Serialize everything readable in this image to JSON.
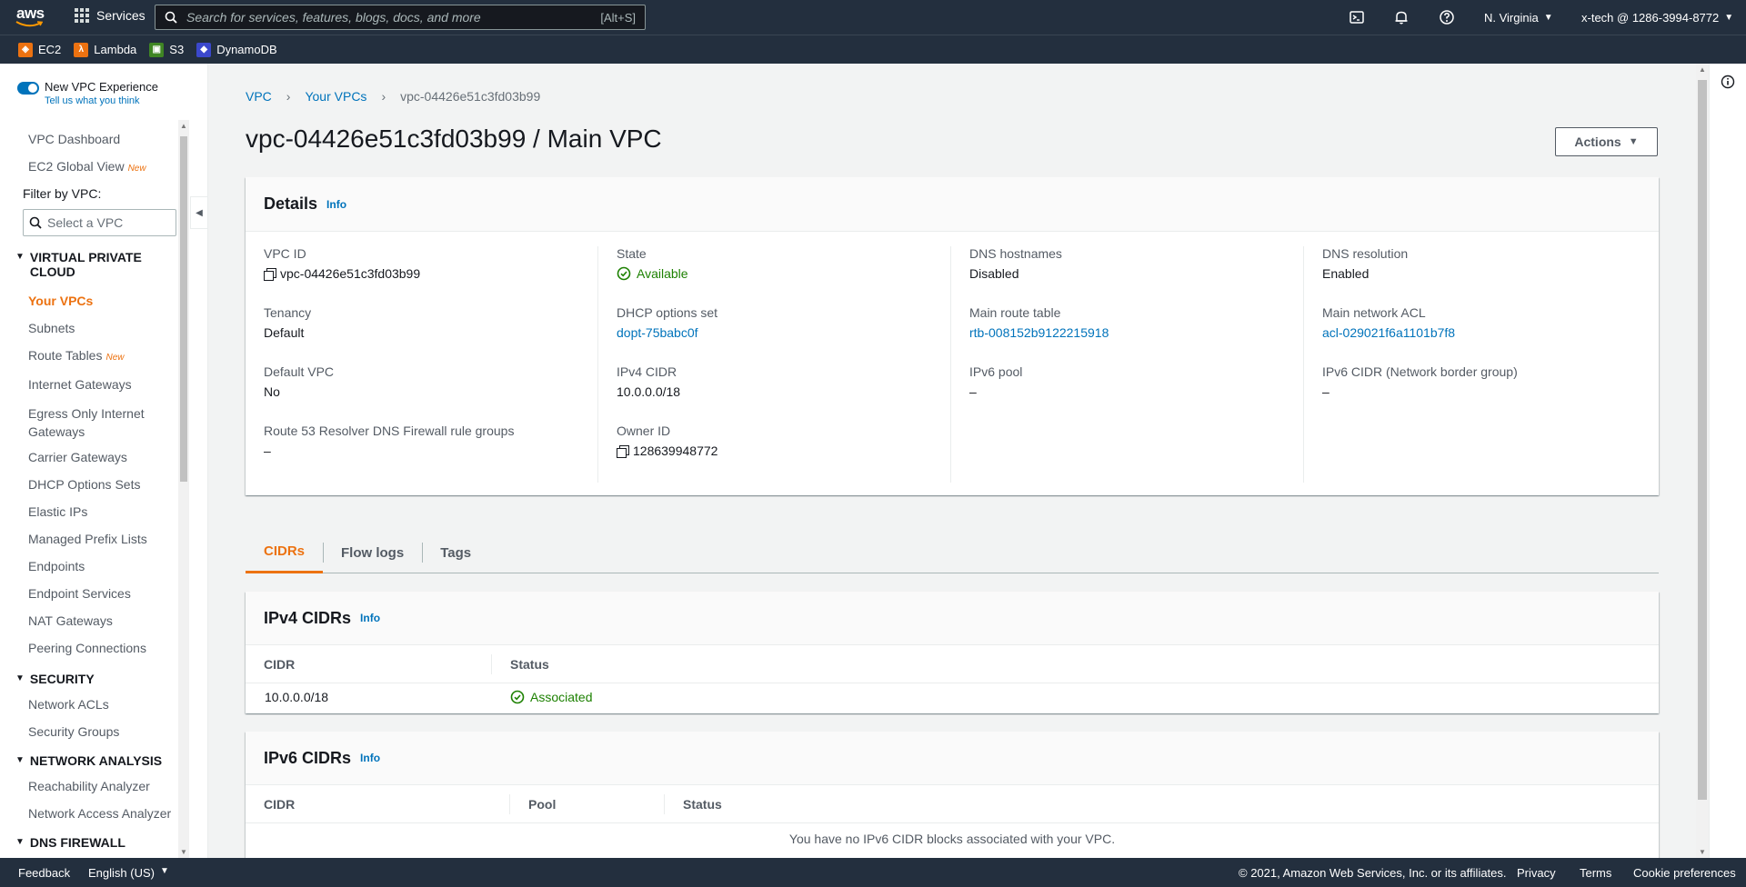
{
  "topnav": {
    "logo_text": "aws",
    "services_label": "Services",
    "search_placeholder": "Search for services, features, blogs, docs, and more",
    "search_shortcut": "[Alt+S]",
    "region": "N. Virginia",
    "account": "x-tech @ 1286-3994-8772"
  },
  "favorites": [
    {
      "label": "EC2",
      "icon": "ec2-icon",
      "color": "#ec7211"
    },
    {
      "label": "Lambda",
      "icon": "lambda-icon",
      "color": "#ec7211"
    },
    {
      "label": "S3",
      "icon": "s3-icon",
      "color": "#3f8624"
    },
    {
      "label": "DynamoDB",
      "icon": "dynamodb-icon",
      "color": "#3b48cc"
    }
  ],
  "sidebar": {
    "toggle_label": "New VPC Experience",
    "toggle_sub": "Tell us what you think",
    "top_items": [
      {
        "label": "VPC Dashboard",
        "tag": ""
      },
      {
        "label": "EC2 Global View",
        "tag": "New"
      }
    ],
    "filter_label": "Filter by VPC:",
    "filter_placeholder": "Select a VPC",
    "sections": [
      {
        "title": "VIRTUAL PRIVATE CLOUD"
      },
      {
        "title": "SECURITY"
      },
      {
        "title": "NETWORK ANALYSIS"
      },
      {
        "title": "DNS FIREWALL"
      }
    ],
    "vpc_items": [
      {
        "label": "Your VPCs",
        "tag": ""
      },
      {
        "label": "Subnets",
        "tag": ""
      },
      {
        "label": "Route Tables",
        "tag": "New"
      },
      {
        "label": "Internet Gateways",
        "tag": ""
      },
      {
        "label": "Egress Only Internet Gateways",
        "tag": ""
      },
      {
        "label": "Carrier Gateways",
        "tag": ""
      },
      {
        "label": "DHCP Options Sets",
        "tag": ""
      },
      {
        "label": "Elastic IPs",
        "tag": ""
      },
      {
        "label": "Managed Prefix Lists",
        "tag": ""
      },
      {
        "label": "Endpoints",
        "tag": ""
      },
      {
        "label": "Endpoint Services",
        "tag": ""
      },
      {
        "label": "NAT Gateways",
        "tag": ""
      },
      {
        "label": "Peering Connections",
        "tag": ""
      }
    ],
    "security_items": [
      {
        "label": "Network ACLs"
      },
      {
        "label": "Security Groups"
      }
    ],
    "analysis_items": [
      {
        "label": "Reachability Analyzer"
      },
      {
        "label": "Network Access Analyzer"
      }
    ]
  },
  "breadcrumb": {
    "items": [
      "VPC",
      "Your VPCs"
    ],
    "current": "vpc-04426e51c3fd03b99"
  },
  "page_title": "vpc-04426e51c3fd03b99 / Main VPC",
  "actions_label": "Actions",
  "details": {
    "title": "Details",
    "info": "Info",
    "columns": [
      [
        {
          "label": "VPC ID",
          "value": "vpc-04426e51c3fd03b99",
          "kind": "copy"
        },
        {
          "label": "Tenancy",
          "value": "Default",
          "kind": "text"
        },
        {
          "label": "Default VPC",
          "value": "No",
          "kind": "text"
        },
        {
          "label": "Route 53 Resolver DNS Firewall rule groups",
          "value": "–",
          "kind": "text"
        }
      ],
      [
        {
          "label": "State",
          "value": "Available",
          "kind": "status"
        },
        {
          "label": "DHCP options set",
          "value": "dopt-75babc0f",
          "kind": "link"
        },
        {
          "label": "IPv4 CIDR",
          "value": "10.0.0.0/18",
          "kind": "text"
        },
        {
          "label": "Owner ID",
          "value": "128639948772",
          "kind": "copy"
        }
      ],
      [
        {
          "label": "DNS hostnames",
          "value": "Disabled",
          "kind": "text"
        },
        {
          "label": "Main route table",
          "value": "rtb-008152b9122215918",
          "kind": "link"
        },
        {
          "label": "IPv6 pool",
          "value": "–",
          "kind": "text"
        }
      ],
      [
        {
          "label": "DNS resolution",
          "value": "Enabled",
          "kind": "text"
        },
        {
          "label": "Main network ACL",
          "value": "acl-029021f6a1101b7f8",
          "kind": "link"
        },
        {
          "label": "IPv6 CIDR (Network border group)",
          "value": "–",
          "kind": "text"
        }
      ]
    ]
  },
  "tabs": [
    "CIDRs",
    "Flow logs",
    "Tags"
  ],
  "ipv4": {
    "title": "IPv4 CIDRs",
    "info": "Info",
    "headers": [
      "CIDR",
      "Status"
    ],
    "rows": [
      {
        "cidr": "10.0.0.0/18",
        "status": "Associated"
      }
    ]
  },
  "ipv6": {
    "title": "IPv6 CIDRs",
    "info": "Info",
    "headers": [
      "CIDR",
      "Pool",
      "Status"
    ],
    "empty": "You have no IPv6 CIDR blocks associated with your VPC."
  },
  "footer": {
    "feedback": "Feedback",
    "language": "English (US)",
    "copyright": "© 2021, Amazon Web Services, Inc. or its affiliates.",
    "privacy": "Privacy",
    "terms": "Terms",
    "cookies": "Cookie preferences"
  },
  "colors": {
    "nav_bg": "#232f3e",
    "link": "#0073bb",
    "accent": "#ec7211",
    "success": "#1d8102"
  }
}
